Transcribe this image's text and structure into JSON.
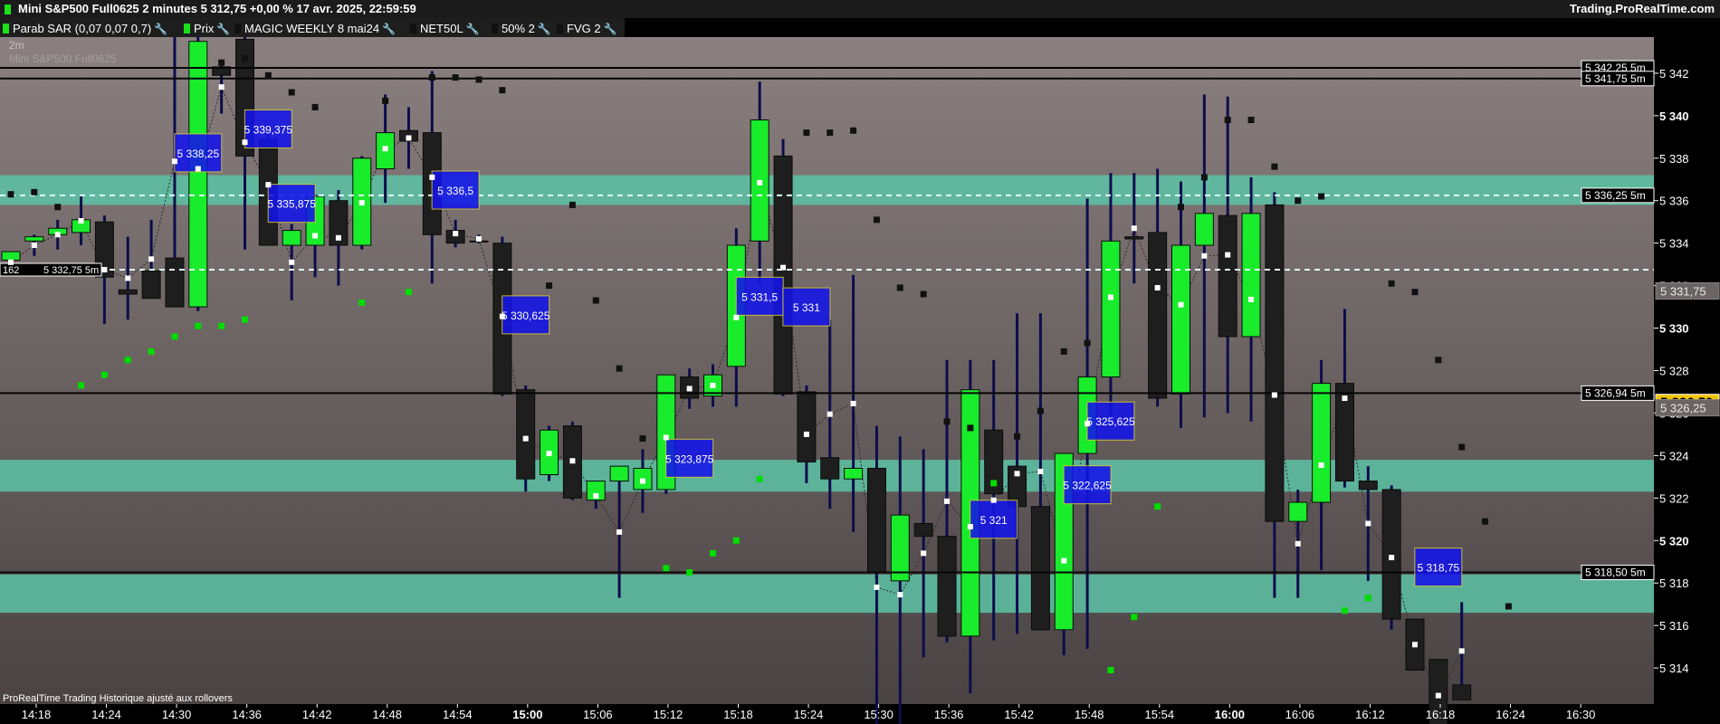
{
  "window": {
    "title": "Mini S&P500 Full0625 2 minutes 5 312,75 +0,00 % 17 avr. 2025, 22:59:59",
    "brand": "Trading.ProRealTime.com"
  },
  "indicators": [
    {
      "label": "Parab SAR (0,07 0,07 0,7)",
      "color": "#19e019"
    },
    {
      "label": "Prix",
      "color": "#19e019"
    },
    {
      "label": "MAGIC WEEKLY 8 mai24",
      "color": "#111111"
    },
    {
      "label": "NET50L",
      "color": "#111111"
    },
    {
      "label": "50% 2",
      "color": "#111111"
    },
    {
      "label": "FVG 2",
      "color": "#111111"
    }
  ],
  "overlay_text": {
    "timeframe": "2m",
    "instrument": "Mini S&P500 Full0625",
    "footer": "ProRealTime Trading  Historique ajusté aux rollovers"
  },
  "chart_data": {
    "type": "candlestick",
    "ylim": [
      5312.3,
      5343.7
    ],
    "yticks": [
      5314,
      5316,
      5318,
      5320,
      5322,
      5324,
      5326,
      5328,
      5330,
      5332,
      5334,
      5336,
      5338,
      5340,
      5342
    ],
    "ytick_labels": [
      "5 314",
      "5 316",
      "5 318",
      "5 320",
      "5 322",
      "5 324",
      "5 326",
      "5 328",
      "5 330",
      "5 332",
      "5 334",
      "5 336",
      "5 338",
      "5 340",
      "5 342"
    ],
    "bold_yticks": [
      5320,
      5330,
      5340
    ],
    "xtick_labels": [
      {
        "label": "14:18",
        "i": 0
      },
      {
        "label": "14:24",
        "i": 3
      },
      {
        "label": "14:30",
        "i": 6
      },
      {
        "label": "14:36",
        "i": 9
      },
      {
        "label": "14:42",
        "i": 12
      },
      {
        "label": "14:48",
        "i": 15
      },
      {
        "label": "14:54",
        "i": 18
      },
      {
        "label": "15:00",
        "i": 21,
        "bold": true
      },
      {
        "label": "15:06",
        "i": 24
      },
      {
        "label": "15:12",
        "i": 27
      },
      {
        "label": "15:18",
        "i": 30
      },
      {
        "label": "15:24",
        "i": 33
      },
      {
        "label": "15:30",
        "i": 36
      },
      {
        "label": "15:36",
        "i": 39
      },
      {
        "label": "15:42",
        "i": 42
      },
      {
        "label": "15:48",
        "i": 45
      },
      {
        "label": "15:54",
        "i": 48
      },
      {
        "label": "16:00",
        "i": 51,
        "bold": true
      },
      {
        "label": "16:06",
        "i": 54
      },
      {
        "label": "16:12",
        "i": 57
      },
      {
        "label": "16:18",
        "i": 60
      },
      {
        "label": "16:24",
        "i": 63
      },
      {
        "label": "16:30",
        "i": 66
      }
    ],
    "candles": [
      {
        "o": 5333.2,
        "h": 5333.5,
        "l": 5332.7,
        "c": 5333.6
      },
      {
        "o": 5334.1,
        "h": 5334.4,
        "l": 5333.4,
        "c": 5334.3
      },
      {
        "o": 5334.4,
        "h": 5335.1,
        "l": 5333.7,
        "c": 5334.7
      },
      {
        "o": 5334.5,
        "h": 5336.2,
        "l": 5333.9,
        "c": 5335.1
      },
      {
        "o": 5335.0,
        "h": 5335.3,
        "l": 5330.2,
        "c": 5332.4
      },
      {
        "o": 5331.8,
        "h": 5334.3,
        "l": 5330.4,
        "c": 5331.6
      },
      {
        "o": 5332.7,
        "h": 5335.1,
        "l": 5331.4,
        "c": 5331.4
      },
      {
        "o": 5333.3,
        "h": 5344.2,
        "l": 5331.5,
        "c": 5331.0
      },
      {
        "o": 5331.0,
        "h": 5344.2,
        "l": 5330.8,
        "c": 5343.5
      },
      {
        "o": 5342.3,
        "h": 5342.6,
        "l": 5340.1,
        "c": 5341.9
      },
      {
        "o": 5343.6,
        "h": 5343.8,
        "l": 5333.7,
        "c": 5338.1
      },
      {
        "o": 5338.9,
        "h": 5339.6,
        "l": 5333.9,
        "c": 5333.9
      },
      {
        "o": 5333.9,
        "h": 5334.9,
        "l": 5331.3,
        "c": 5334.6
      },
      {
        "o": 5333.9,
        "h": 5336.3,
        "l": 5332.4,
        "c": 5336.2
      },
      {
        "o": 5336.0,
        "h": 5336.5,
        "l": 5332.0,
        "c": 5333.9
      },
      {
        "o": 5333.9,
        "h": 5338.1,
        "l": 5333.7,
        "c": 5338.0
      },
      {
        "o": 5337.5,
        "h": 5341.0,
        "l": 5335.9,
        "c": 5339.2
      },
      {
        "o": 5339.3,
        "h": 5340.4,
        "l": 5337.5,
        "c": 5338.8
      },
      {
        "o": 5339.2,
        "h": 5342.1,
        "l": 5332.1,
        "c": 5334.4
      },
      {
        "o": 5334.6,
        "h": 5335.1,
        "l": 5333.8,
        "c": 5334.0
      },
      {
        "o": 5334.1,
        "h": 5334.4,
        "l": 5334.0,
        "c": 5334.1
      },
      {
        "o": 5334.0,
        "h": 5334.3,
        "l": 5326.8,
        "c": 5326.9
      },
      {
        "o": 5327.1,
        "h": 5327.3,
        "l": 5322.3,
        "c": 5322.9
      },
      {
        "o": 5323.1,
        "h": 5325.4,
        "l": 5322.8,
        "c": 5325.2
      },
      {
        "o": 5325.4,
        "h": 5325.6,
        "l": 5321.9,
        "c": 5322.0
      },
      {
        "o": 5321.9,
        "h": 5322.7,
        "l": 5321.5,
        "c": 5322.8
      },
      {
        "o": 5322.8,
        "h": 5323.5,
        "l": 5317.3,
        "c": 5323.5
      },
      {
        "o": 5322.4,
        "h": 5324.3,
        "l": 5321.3,
        "c": 5323.4
      },
      {
        "o": 5322.4,
        "h": 5327.5,
        "l": 5322.2,
        "c": 5327.8
      },
      {
        "o": 5327.7,
        "h": 5328.1,
        "l": 5326.2,
        "c": 5326.7
      },
      {
        "o": 5326.8,
        "h": 5328.3,
        "l": 5326.3,
        "c": 5327.8
      },
      {
        "o": 5328.2,
        "h": 5334.7,
        "l": 5326.3,
        "c": 5333.9
      },
      {
        "o": 5334.1,
        "h": 5341.6,
        "l": 5332.1,
        "c": 5339.8
      },
      {
        "o": 5338.1,
        "h": 5338.9,
        "l": 5326.8,
        "c": 5326.9
      },
      {
        "o": 5327.0,
        "h": 5327.3,
        "l": 5322.7,
        "c": 5323.7
      },
      {
        "o": 5323.9,
        "h": 5330.4,
        "l": 5321.5,
        "c": 5322.9
      },
      {
        "o": 5322.9,
        "h": 5332.5,
        "l": 5320.4,
        "c": 5323.4
      },
      {
        "o": 5323.4,
        "h": 5325.4,
        "l": 5310.2,
        "c": 5318.5
      },
      {
        "o": 5318.1,
        "h": 5324.9,
        "l": 5310.0,
        "c": 5321.2
      },
      {
        "o": 5320.8,
        "h": 5324.3,
        "l": 5314.5,
        "c": 5320.2
      },
      {
        "o": 5320.2,
        "h": 5328.5,
        "l": 5315.2,
        "c": 5315.5
      },
      {
        "o": 5315.5,
        "h": 5328.5,
        "l": 5312.8,
        "c": 5327.1
      },
      {
        "o": 5325.2,
        "h": 5328.5,
        "l": 5315.3,
        "c": 5322.2
      },
      {
        "o": 5323.5,
        "h": 5330.7,
        "l": 5315.6,
        "c": 5321.6
      },
      {
        "o": 5321.6,
        "h": 5330.7,
        "l": 5315.8,
        "c": 5315.8
      },
      {
        "o": 5315.8,
        "h": 5323.5,
        "l": 5314.6,
        "c": 5324.1
      },
      {
        "o": 5324.1,
        "h": 5336.1,
        "l": 5314.9,
        "c": 5327.7
      },
      {
        "o": 5327.7,
        "h": 5337.3,
        "l": 5325.6,
        "c": 5334.1
      },
      {
        "o": 5334.3,
        "h": 5337.3,
        "l": 5332.1,
        "c": 5334.2
      },
      {
        "o": 5334.5,
        "h": 5337.5,
        "l": 5326.3,
        "c": 5326.7
      },
      {
        "o": 5326.9,
        "h": 5336.9,
        "l": 5325.3,
        "c": 5333.9
      },
      {
        "o": 5333.9,
        "h": 5341.0,
        "l": 5325.8,
        "c": 5335.4
      },
      {
        "o": 5335.3,
        "h": 5340.9,
        "l": 5326.0,
        "c": 5329.6
      },
      {
        "o": 5329.6,
        "h": 5337.1,
        "l": 5325.6,
        "c": 5335.4
      },
      {
        "o": 5335.8,
        "h": 5336.4,
        "l": 5317.3,
        "c": 5320.9
      },
      {
        "o": 5320.9,
        "h": 5322.4,
        "l": 5317.3,
        "c": 5321.8
      },
      {
        "o": 5321.8,
        "h": 5328.5,
        "l": 5318.6,
        "c": 5327.4
      },
      {
        "o": 5327.4,
        "h": 5330.9,
        "l": 5322.5,
        "c": 5322.8
      },
      {
        "o": 5322.8,
        "h": 5323.5,
        "l": 5318.1,
        "c": 5322.4
      },
      {
        "o": 5322.4,
        "h": 5322.6,
        "l": 5315.8,
        "c": 5316.3
      },
      {
        "o": 5316.3,
        "h": 5316.3,
        "l": 5313.9,
        "c": 5313.9
      },
      {
        "o": 5314.4,
        "h": 5314.4,
        "l": 5311.0,
        "c": 5311.0
      },
      {
        "o": 5313.2,
        "h": 5317.1,
        "l": 5312.5,
        "c": 5312.5
      }
    ],
    "sar_points": [
      {
        "i": -1,
        "v": 5339.8,
        "c": "b"
      },
      {
        "i": 0,
        "v": 5336.3,
        "c": "b"
      },
      {
        "i": 1,
        "v": 5336.4,
        "c": "b"
      },
      {
        "i": 2,
        "v": 5335.7,
        "c": "b"
      },
      {
        "i": 3,
        "v": 5327.3,
        "c": "g"
      },
      {
        "i": 4,
        "v": 5327.8,
        "c": "g"
      },
      {
        "i": 5,
        "v": 5328.5,
        "c": "g"
      },
      {
        "i": 6,
        "v": 5328.9,
        "c": "g"
      },
      {
        "i": 7,
        "v": 5329.6,
        "c": "g"
      },
      {
        "i": 8,
        "v": 5330.1,
        "c": "g"
      },
      {
        "i": 9,
        "v": 5330.1,
        "c": "g"
      },
      {
        "i": 10,
        "v": 5330.4,
        "c": "g"
      },
      {
        "i": 9,
        "v": 5342.5,
        "c": "b"
      },
      {
        "i": 10,
        "v": 5342.7,
        "c": "b"
      },
      {
        "i": 11,
        "v": 5341.9,
        "c": "b"
      },
      {
        "i": 12,
        "v": 5341.1,
        "c": "b"
      },
      {
        "i": 13,
        "v": 5340.4,
        "c": "b"
      },
      {
        "i": 15,
        "v": 5331.2,
        "c": "g"
      },
      {
        "i": 16,
        "v": 5340.7,
        "c": "b"
      },
      {
        "i": 17,
        "v": 5331.7,
        "c": "g"
      },
      {
        "i": 18,
        "v": 5341.8,
        "c": "b"
      },
      {
        "i": 19,
        "v": 5341.8,
        "c": "b"
      },
      {
        "i": 20,
        "v": 5341.7,
        "c": "b"
      },
      {
        "i": 21,
        "v": 5341.2,
        "c": "b"
      },
      {
        "i": 23,
        "v": 5332.0,
        "c": "b"
      },
      {
        "i": 24,
        "v": 5335.8,
        "c": "b"
      },
      {
        "i": 25,
        "v": 5331.3,
        "c": "b"
      },
      {
        "i": 26,
        "v": 5328.1,
        "c": "b"
      },
      {
        "i": 27,
        "v": 5324.8,
        "c": "b"
      },
      {
        "i": 28,
        "v": 5318.7,
        "c": "g"
      },
      {
        "i": 29,
        "v": 5318.5,
        "c": "g"
      },
      {
        "i": 30,
        "v": 5319.4,
        "c": "g"
      },
      {
        "i": 31,
        "v": 5320.0,
        "c": "g"
      },
      {
        "i": 32,
        "v": 5322.9,
        "c": "g"
      },
      {
        "i": 34,
        "v": 5339.2,
        "c": "b"
      },
      {
        "i": 35,
        "v": 5339.2,
        "c": "b"
      },
      {
        "i": 36,
        "v": 5339.3,
        "c": "b"
      },
      {
        "i": 37,
        "v": 5335.1,
        "c": "b"
      },
      {
        "i": 38,
        "v": 5331.9,
        "c": "b"
      },
      {
        "i": 39,
        "v": 5331.6,
        "c": "b"
      },
      {
        "i": 40,
        "v": 5325.6,
        "c": "b"
      },
      {
        "i": 41,
        "v": 5325.3,
        "c": "b"
      },
      {
        "i": 42,
        "v": 5322.7,
        "c": "g"
      },
      {
        "i": 43,
        "v": 5324.9,
        "c": "b"
      },
      {
        "i": 44,
        "v": 5326.1,
        "c": "b"
      },
      {
        "i": 45,
        "v": 5328.9,
        "c": "b"
      },
      {
        "i": 46,
        "v": 5329.3,
        "c": "b"
      },
      {
        "i": 47,
        "v": 5313.9,
        "c": "g"
      },
      {
        "i": 48,
        "v": 5316.4,
        "c": "g"
      },
      {
        "i": 49,
        "v": 5321.6,
        "c": "g"
      },
      {
        "i": 50,
        "v": 5335.7,
        "c": "b"
      },
      {
        "i": 51,
        "v": 5337.1,
        "c": "b"
      },
      {
        "i": 52,
        "v": 5339.8,
        "c": "b"
      },
      {
        "i": 53,
        "v": 5339.8,
        "c": "b"
      },
      {
        "i": 54,
        "v": 5337.6,
        "c": "b"
      },
      {
        "i": 55,
        "v": 5336.0,
        "c": "b"
      },
      {
        "i": 56,
        "v": 5336.2,
        "c": "b"
      },
      {
        "i": 57,
        "v": 5316.7,
        "c": "g"
      },
      {
        "i": 58,
        "v": 5317.3,
        "c": "g"
      },
      {
        "i": 59,
        "v": 5332.1,
        "c": "b"
      },
      {
        "i": 60,
        "v": 5331.7,
        "c": "b"
      },
      {
        "i": 61,
        "v": 5328.5,
        "c": "b"
      },
      {
        "i": 62,
        "v": 5324.4,
        "c": "b"
      },
      {
        "i": 63,
        "v": 5320.9,
        "c": "b"
      },
      {
        "i": 64,
        "v": 5316.9,
        "c": "b"
      }
    ],
    "fifty_pct_markers": [
      {
        "i": 8,
        "v": 5338.25,
        "label": "5 338,25"
      },
      {
        "i": 11,
        "v": 5339.375,
        "label": "5 339,375"
      },
      {
        "i": 12,
        "v": 5335.875,
        "label": "5 335,875"
      },
      {
        "i": 19,
        "v": 5336.5,
        "label": "5 336,5"
      },
      {
        "i": 22,
        "v": 5330.625,
        "label": "5 330,625"
      },
      {
        "i": 29,
        "v": 5323.875,
        "label": "5 323,875"
      },
      {
        "i": 32,
        "v": 5331.5,
        "label": "5 331,5"
      },
      {
        "i": 34,
        "v": 5331.0,
        "label": "5 331"
      },
      {
        "i": 42,
        "v": 5321.0,
        "label": "5 321"
      },
      {
        "i": 46,
        "v": 5322.625,
        "label": "5 322,625"
      },
      {
        "i": 47,
        "v": 5325.625,
        "label": "5 325,625"
      },
      {
        "i": 61,
        "v": 5318.75,
        "label": "5 318,75"
      }
    ],
    "fvg_zones": [
      [
        5335.8,
        5337.2
      ],
      [
        5322.3,
        5323.8
      ],
      [
        5316.6,
        5318.4
      ]
    ],
    "levels": [
      {
        "v": 5342.25,
        "label": "5 342,25 5m",
        "style": "solid"
      },
      {
        "v": 5341.75,
        "label": "5 341,75 5m",
        "style": "solid"
      },
      {
        "v": 5336.25,
        "label": "5 336,25 5m",
        "style": "dashed"
      },
      {
        "v": 5332.75,
        "label": "5 332,75 5m",
        "style": "dashed",
        "left_label": "162"
      },
      {
        "v": 5326.94,
        "label": "5 326,94 5m",
        "style": "solid"
      },
      {
        "v": 5318.5,
        "label": "5 318,50 5m",
        "style": "solid"
      }
    ],
    "price_tags": [
      {
        "v": 5331.75,
        "label": "5 331,75",
        "kind": "grey"
      },
      {
        "v": 5326.5,
        "label": "5 326,50",
        "kind": "last"
      },
      {
        "v": 5326.25,
        "label": "5 326,25",
        "kind": "grey"
      }
    ],
    "colors": {
      "bull": "#19ec2b",
      "bear": "#1e1e1e",
      "wick": "#0d0d4a",
      "sar_bull": "#00dd00",
      "sar_bear": "#111111",
      "fvg": "#5cc3a6",
      "marker": "#1414e8",
      "marker_border": "#d8c830",
      "last_price": "#f1c600"
    }
  }
}
